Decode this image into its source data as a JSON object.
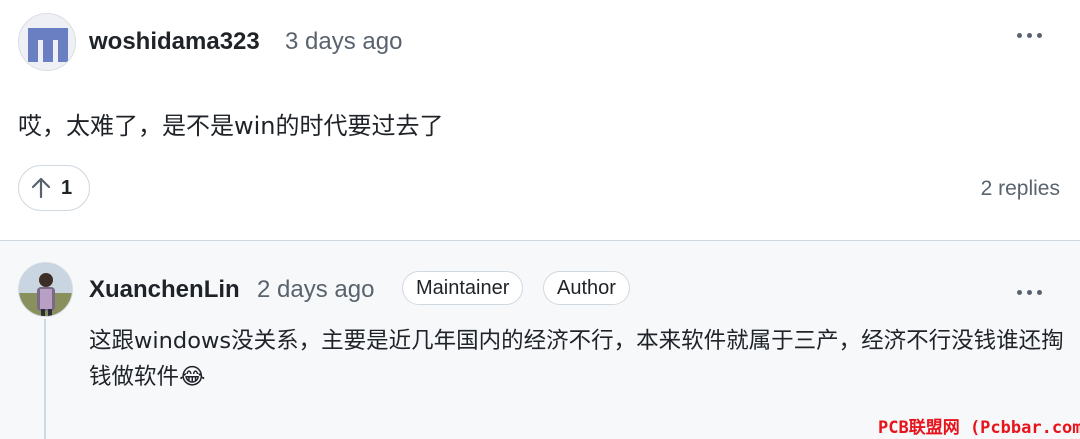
{
  "comment": {
    "author": "woshidama323",
    "time": "3 days ago",
    "body": "哎，太难了，是不是win的时代要过去了",
    "upvotes": "1",
    "replies_label": "2 replies"
  },
  "reply": {
    "author": "XuanchenLin",
    "time": "2 days ago",
    "badges": [
      "Maintainer",
      "Author"
    ],
    "body": "这跟windows没关系，主要是近几年国内的经济不行，本来软件就属于三产，经济不行没钱谁还掏钱做软件😂"
  },
  "watermark": "PCB联盟网 (Pcbbar.com)",
  "colors": {
    "accent_avatar": "#6a7fc1",
    "watermark": "#e8141b"
  },
  "icons": [
    "more-horizontal-icon",
    "arrow-up-icon"
  ]
}
